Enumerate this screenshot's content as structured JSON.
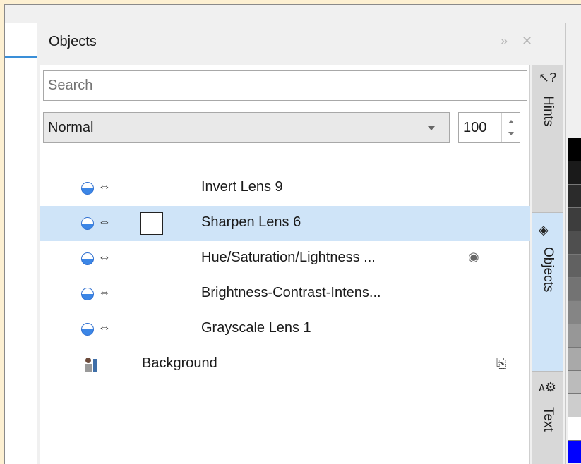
{
  "docker": {
    "title": "Objects",
    "expand_icon": "double-chevron-right-icon",
    "close_icon": "close-icon"
  },
  "search": {
    "placeholder": "Search"
  },
  "blend": {
    "mode": "Normal",
    "opacity": "100"
  },
  "layers": [
    {
      "name": "Invert Lens 9",
      "selected": false,
      "hidden": false
    },
    {
      "name": "Sharpen Lens 6",
      "selected": true,
      "hidden": false
    },
    {
      "name": "Hue/Saturation/Lightness ...",
      "selected": false,
      "hidden": true
    },
    {
      "name": "Brightness-Contrast-Intens...",
      "selected": false,
      "hidden": false
    },
    {
      "name": "Grayscale Lens 1",
      "selected": false,
      "hidden": false
    }
  ],
  "background": {
    "name": "Background"
  },
  "tabs": [
    {
      "label": "Hints",
      "icon": "pointer-question-icon",
      "active": false
    },
    {
      "label": "Objects",
      "icon": "layers-icon",
      "active": true
    },
    {
      "label": "Text",
      "icon": "text-settings-icon",
      "active": false
    }
  ],
  "palette": [
    "#000000",
    "#1a1a1a",
    "#2b2b2b",
    "#3d3d3d",
    "#4f4f4f",
    "#616161",
    "#737373",
    "#858585",
    "#979797",
    "#a9a9a9",
    "#bbbbbb",
    "#cdcdcd",
    "#ffffff",
    "#0000ff"
  ],
  "colors": {
    "accent": "#3a8fd8",
    "selected_row": "#cfe4f8"
  }
}
